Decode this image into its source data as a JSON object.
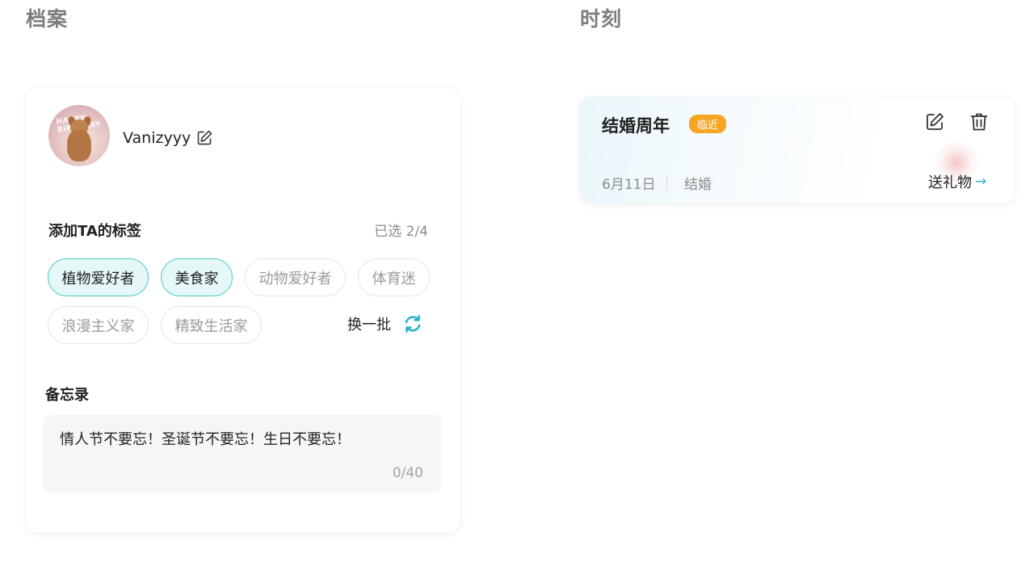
{
  "sections": {
    "profile_title": "档案",
    "moments_title": "时刻"
  },
  "profile": {
    "avatar_banner": "HAPPY BIRTHDAY",
    "username": "Vanizyyy",
    "tags_heading": "添加TA的标签",
    "tags_count": "已选 2/4",
    "tags": [
      {
        "label": "植物爱好者",
        "selected": true
      },
      {
        "label": "美食家",
        "selected": true
      },
      {
        "label": "动物爱好者",
        "selected": false
      },
      {
        "label": "体育迷",
        "selected": false
      },
      {
        "label": "浪漫主义家",
        "selected": false
      },
      {
        "label": "精致生活家",
        "selected": false
      }
    ],
    "refresh_label": "换一批",
    "memo_heading": "备忘录",
    "memo_text": "情人节不要忘！圣诞节不要忘！生日不要忘！",
    "memo_count": "0/40"
  },
  "moment": {
    "title": "结婚周年",
    "badge": "临近",
    "date": "6月11日",
    "type": "结婚",
    "gift_label": "送礼物",
    "gift_arrow": "→"
  },
  "colors": {
    "accent_teal": "#4fc8c8",
    "badge_orange": "#f6a623",
    "refresh_blue": "#2bb3c7"
  },
  "icons": {
    "profile_edit": "edit-icon",
    "refresh": "refresh-icon",
    "moment_edit": "edit-icon",
    "moment_delete": "trash-icon",
    "gift_arrow": "arrow-right-icon"
  }
}
